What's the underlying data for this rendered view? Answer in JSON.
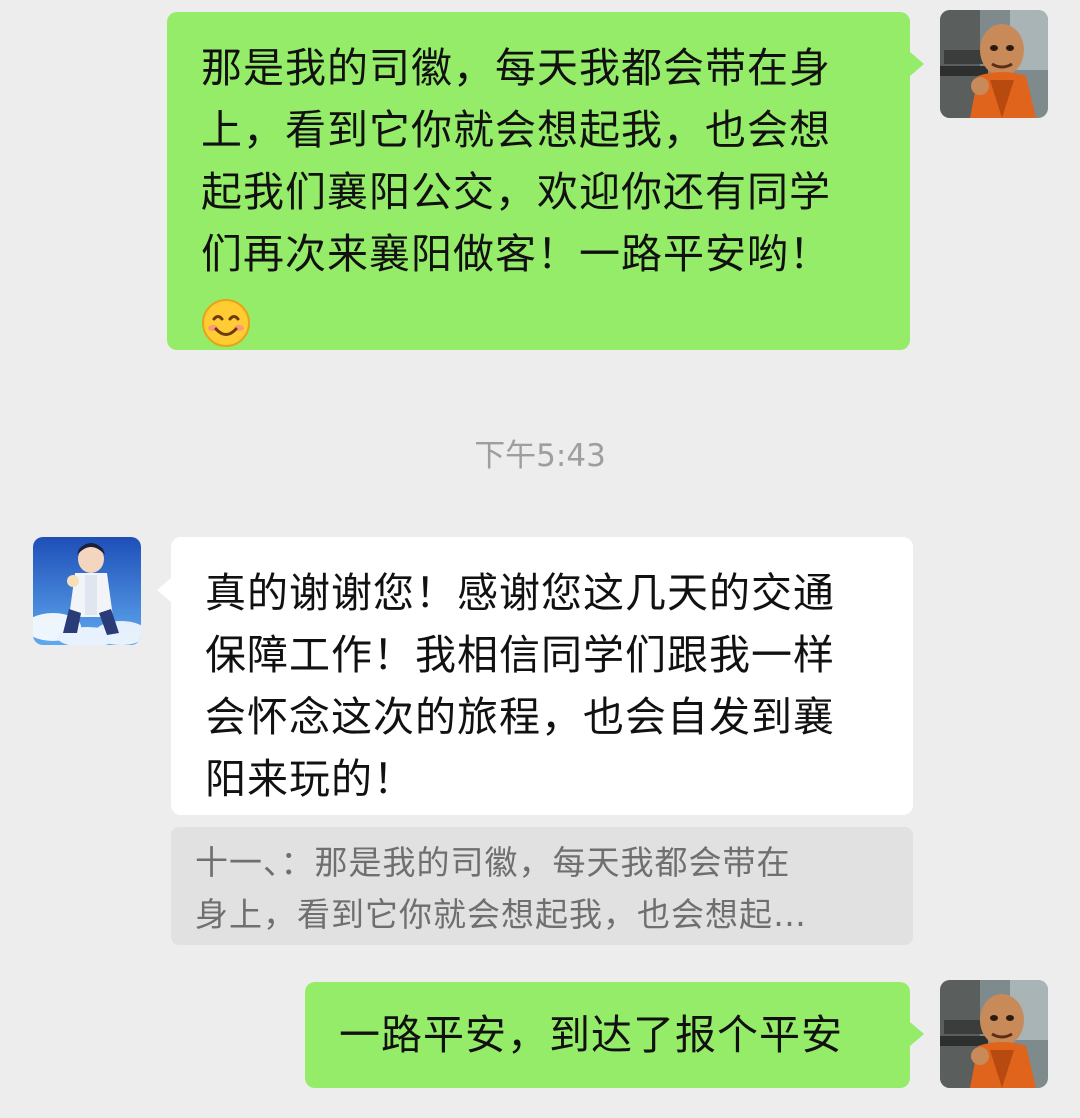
{
  "messages": [
    {
      "side": "right",
      "lines": [
        "那是我的司徽，每天我都会带在身",
        "上，看到它你就会想起我，也会想",
        "起我们襄阳公交，欢迎你还有同学",
        "们再次来襄阳做客！一路平安哟！"
      ],
      "emoji": "smiling-face-emoji"
    },
    {
      "side": "left",
      "lines": [
        "真的谢谢您！感谢您这几天的交通",
        "保障工作！我相信同学们跟我一样",
        "会怀念这次的旅程，也会自发到襄",
        "阳来玩的！"
      ]
    },
    {
      "side": "right",
      "lines": [
        "一路平安，到达了报个平安"
      ]
    }
  ],
  "timestamp": "下午5:43",
  "quote": {
    "lines": [
      "十一、：那是我的司徽，每天我都会带在",
      "身上，看到它你就会想起我，也会想起…"
    ]
  },
  "colors": {
    "background": "#ededed",
    "my_bubble": "#95ec69",
    "their_bubble": "#ffffff",
    "quote_bg": "#e1e1e1",
    "timestamp_text": "#9e9e9e"
  },
  "icons": {
    "my_avatar": "orange-robed-character-avatar",
    "their_avatar": "anime-boy-blue-sky-avatar",
    "emoji": "smiling-face-emoji"
  }
}
